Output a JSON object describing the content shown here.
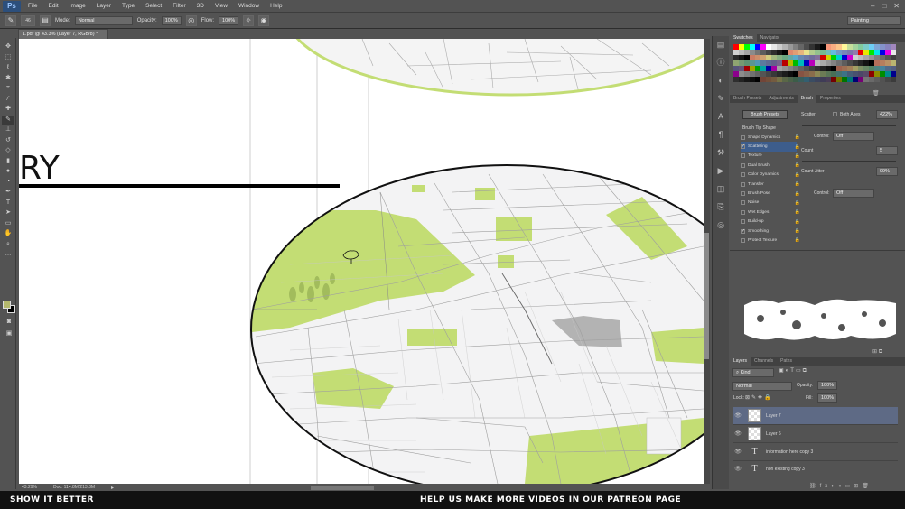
{
  "app": {
    "logo": "Ps"
  },
  "menu": [
    "File",
    "Edit",
    "Image",
    "Layer",
    "Type",
    "Select",
    "Filter",
    "3D",
    "View",
    "Window",
    "Help"
  ],
  "window_controls": [
    "–",
    "□",
    "✕"
  ],
  "options": {
    "brush_size": "46",
    "mode_label": "Mode:",
    "mode_value": "Normal",
    "opacity_label": "Opacity:",
    "opacity_value": "100%",
    "flow_label": "Flow:",
    "flow_value": "100%",
    "workspace": "Painting"
  },
  "document": {
    "tab_title": "1.pdf @ 43.3% (Layer 7, RGB/8) *",
    "heading_fragment": "RY",
    "zoom": "43.29%",
    "doc_info": "Doc: 114.8M/213.3M"
  },
  "tools": [
    "move-tool",
    "marquee-tool",
    "lasso-tool",
    "quick-select-tool",
    "crop-tool",
    "eyedropper-tool",
    "healing-tool",
    "brush-tool",
    "stamp-tool",
    "history-brush-tool",
    "eraser-tool",
    "gradient-tool",
    "blur-tool",
    "dodge-tool",
    "pen-tool",
    "type-tool",
    "path-select-tool",
    "shape-tool",
    "hand-tool",
    "zoom-tool"
  ],
  "swatches_panel": {
    "tabs": [
      "Swatches",
      "Navigator"
    ],
    "colors": [
      "#ff0000",
      "#ffff00",
      "#00ff00",
      "#00ffff",
      "#0000ff",
      "#ff00ff",
      "#ffffff",
      "#e6e6e6",
      "#cccccc",
      "#b3b3b3",
      "#999999",
      "#808080",
      "#666666",
      "#4d4d4d",
      "#333333",
      "#1a1a1a",
      "#000000",
      "#f7977a",
      "#f9ad81",
      "#fdc68a",
      "#fff79a",
      "#c4df9b",
      "#a2d39c",
      "#82ca9d",
      "#7bcdc8",
      "#6ecff6",
      "#7ea7d8",
      "#8493ca",
      "#8882be",
      "#a187be"
    ]
  },
  "brush_panel": {
    "tabs": [
      "Brush Presets",
      "Adjustments",
      "Brush",
      "Properties"
    ],
    "presets_button": "Brush Presets",
    "header": "Brush Tip Shape",
    "items": [
      {
        "label": "Shape Dynamics",
        "checked": false,
        "selected": false
      },
      {
        "label": "Scattering",
        "checked": true,
        "selected": true
      },
      {
        "label": "Texture",
        "checked": false,
        "selected": false
      },
      {
        "label": "Dual Brush",
        "checked": false,
        "selected": false
      },
      {
        "label": "Color Dynamics",
        "checked": false,
        "selected": false
      },
      {
        "label": "Transfer",
        "checked": false,
        "selected": false
      },
      {
        "label": "Brush Pose",
        "checked": false,
        "selected": false
      },
      {
        "label": "Noise",
        "checked": false,
        "selected": false
      },
      {
        "label": "Wet Edges",
        "checked": false,
        "selected": false
      },
      {
        "label": "Build-up",
        "checked": false,
        "selected": false
      },
      {
        "label": "Smoothing",
        "checked": true,
        "selected": false
      },
      {
        "label": "Protect Texture",
        "checked": false,
        "selected": false
      }
    ],
    "scatter_label": "Scatter",
    "both_axes_label": "Both Axes",
    "scatter_value": "422%",
    "control_label": "Control:",
    "control_value": "Off",
    "count_label": "Count",
    "count_value": "5",
    "count_jitter_label": "Count Jitter",
    "count_jitter_value": "99%",
    "control2_value": "Off"
  },
  "layers_panel": {
    "tabs": [
      "Layers",
      "Channels",
      "Paths"
    ],
    "kind_filter": "Kind",
    "blend_mode": "Normal",
    "opacity_label": "Opacity:",
    "opacity_value": "100%",
    "lock_label": "Lock:",
    "fill_label": "Fill:",
    "fill_value": "100%",
    "layers": [
      {
        "name": "Layer 7",
        "type": "raster",
        "selected": true
      },
      {
        "name": "Layer 6",
        "type": "raster",
        "selected": false
      },
      {
        "name": "information here copy 3",
        "type": "text",
        "selected": false
      },
      {
        "name": "non existing copy 3",
        "type": "text",
        "selected": false
      }
    ]
  },
  "banner": {
    "left": "SHOW IT BETTER",
    "center": "HELP US MAKE MORE VIDEOS IN OUR PATREON PAGE"
  },
  "colors": {
    "park_green": "#c3dd74",
    "fg_color": "#b5b96d",
    "selection_blue": "#3d5d8c"
  }
}
